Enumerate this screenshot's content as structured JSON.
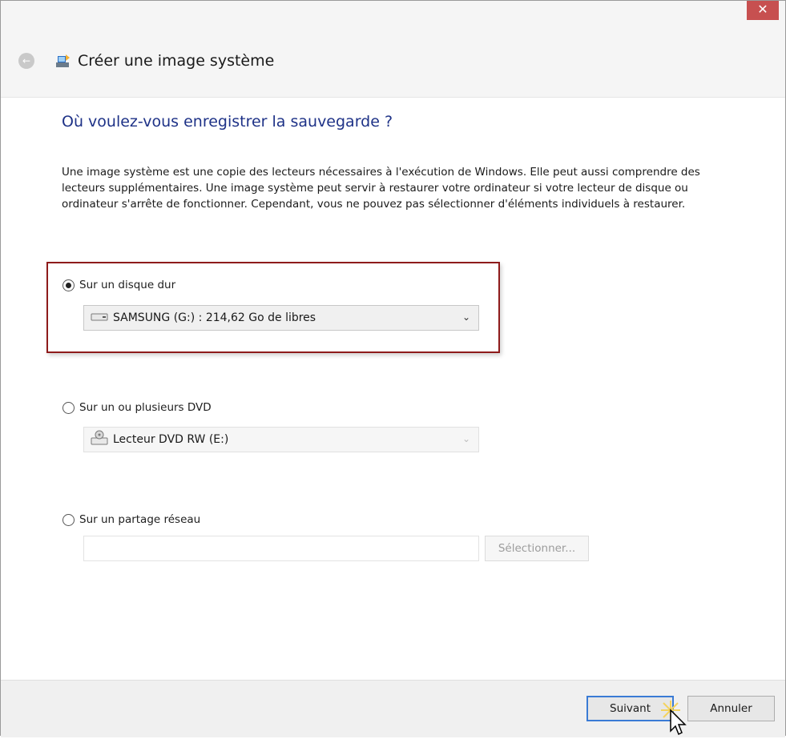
{
  "window": {
    "title": "Créer une image système",
    "close_label": "✕",
    "back_label": "←"
  },
  "page": {
    "heading": "Où voulez-vous enregistrer la sauvegarde ?",
    "description": "Une image système est une copie des lecteurs nécessaires à l'exécution de Windows. Elle peut aussi comprendre des lecteurs supplémentaires. Une image système peut servir à restaurer votre ordinateur si votre lecteur de disque ou ordinateur s'arrête de fonctionner. Cependant, vous ne pouvez pas sélectionner d'éléments individuels à restaurer."
  },
  "options": {
    "hard_disk": {
      "label": "Sur un disque dur",
      "selected": true,
      "value": "SAMSUNG (G:) : 214,62 Go de libres",
      "icon": "hard-drive-icon"
    },
    "dvd": {
      "label": "Sur un ou plusieurs DVD",
      "selected": false,
      "value": "Lecteur DVD RW (E:)",
      "icon": "dvd-drive-icon"
    },
    "network": {
      "label": "Sur un partage réseau",
      "selected": false,
      "input_value": "",
      "select_button_label": "Sélectionner..."
    }
  },
  "footer": {
    "next_label": "Suivant",
    "cancel_label": "Annuler"
  },
  "colors": {
    "heading": "#1e3287",
    "highlight_border": "#8e1b1b",
    "close_button": "#c75050",
    "primary_button_border": "#3a7bd5"
  }
}
